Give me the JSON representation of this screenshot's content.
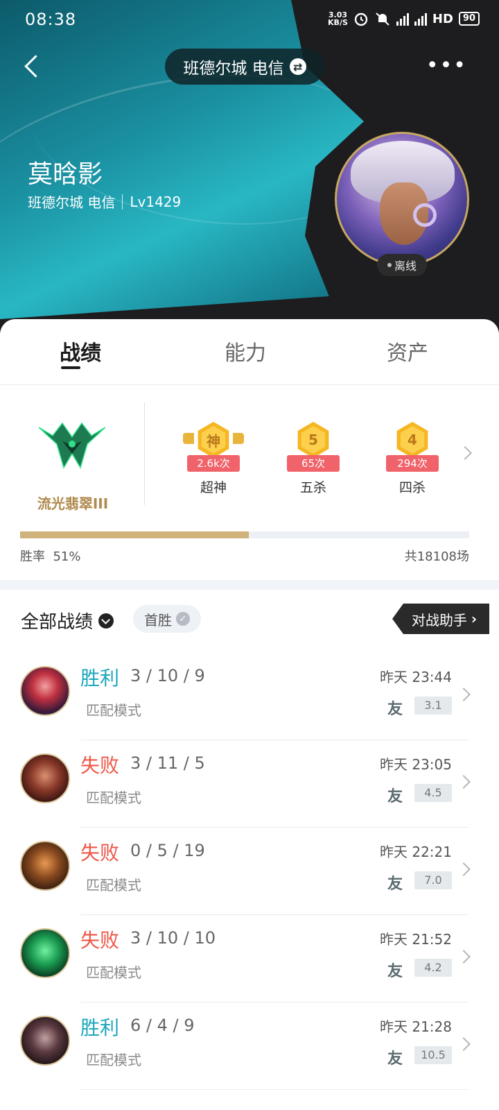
{
  "status": {
    "time": "08:38",
    "net_speed_value": "3.03",
    "net_speed_unit": "KB/S",
    "battery": "90",
    "icons": [
      "alarm-icon",
      "mute-icon",
      "signal-5g-icon",
      "signal-5g-icon",
      "hd-icon",
      "battery-icon"
    ]
  },
  "header": {
    "server": "班德尔城 电信",
    "player_name": "莫晗影",
    "player_server": "班德尔城 电信",
    "player_level": "Lv1429",
    "online_status": "离线"
  },
  "tabs": [
    "战绩",
    "能力",
    "资产"
  ],
  "summary": {
    "rank": "流光翡翠III",
    "achievements": [
      {
        "icon": "神",
        "count": "2.6k次",
        "label": "超神"
      },
      {
        "icon": "5",
        "count": "65次",
        "label": "五杀"
      },
      {
        "icon": "4",
        "count": "294次",
        "label": "四杀"
      }
    ],
    "win_rate_label": "胜率",
    "win_rate": "51%",
    "win_rate_value": 0.51,
    "total_games": "共18108场"
  },
  "matches_header": {
    "filter": "全部战绩",
    "first_win": "首胜",
    "assistant": "对战助手"
  },
  "matches": [
    {
      "result": "胜利",
      "kda": "3 / 10 / 9",
      "mode": "匹配模式",
      "time": "昨天 23:44",
      "teammate": "友",
      "score": "3.1"
    },
    {
      "result": "失败",
      "kda": "3 / 11 / 5",
      "mode": "匹配模式",
      "time": "昨天 23:05",
      "teammate": "友",
      "score": "4.5"
    },
    {
      "result": "失败",
      "kda": "0 / 5 / 19",
      "mode": "匹配模式",
      "time": "昨天 22:21",
      "teammate": "友",
      "score": "7.0"
    },
    {
      "result": "失败",
      "kda": "3 / 10 / 10",
      "mode": "匹配模式",
      "time": "昨天 21:52",
      "teammate": "友",
      "score": "4.2"
    },
    {
      "result": "胜利",
      "kda": "6 / 4 / 9",
      "mode": "匹配模式",
      "time": "昨天 21:28",
      "teammate": "友",
      "score": "10.5"
    }
  ],
  "colors": {
    "win": "#1da6bd",
    "loss": "#ee5546",
    "gold": "#cfb37b",
    "dark": "#1d1d1f"
  }
}
